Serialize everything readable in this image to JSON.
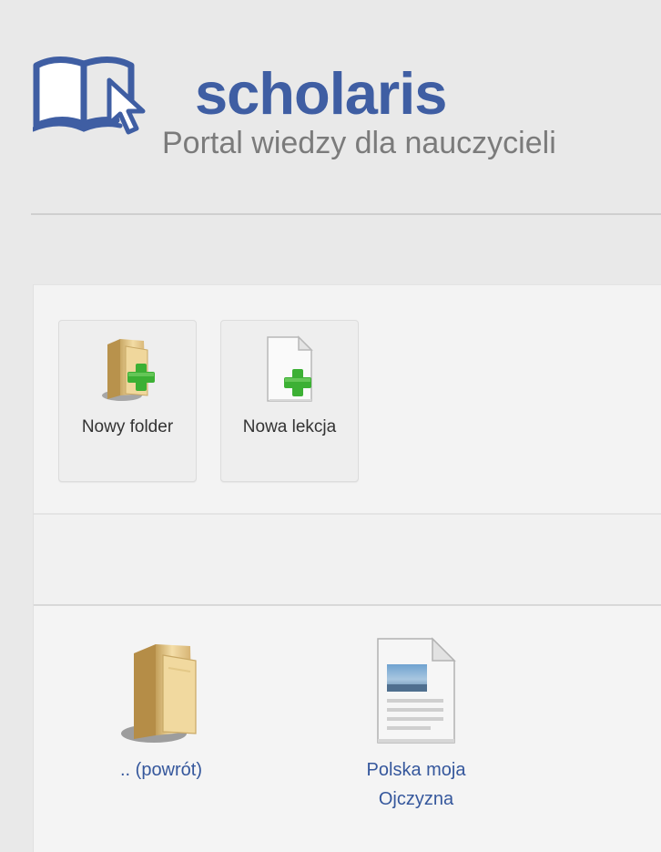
{
  "header": {
    "brand_name": "scholaris",
    "tagline": "Portal wiedzy dla nauczycieli",
    "logo_icon": "open-book-with-cursor-icon",
    "brand_color": "#3f5ea3"
  },
  "toolbar": {
    "buttons": [
      {
        "label": "Nowy folder",
        "icon": "new-folder-icon"
      },
      {
        "label": "Nowa lekcja",
        "icon": "new-lesson-icon"
      }
    ]
  },
  "files": {
    "items": [
      {
        "label": ".. (powrót)",
        "icon": "folder-icon"
      },
      {
        "label": "Polska moja Ojczyzna",
        "icon": "lesson-document-icon"
      }
    ],
    "link_color": "#35579c"
  }
}
